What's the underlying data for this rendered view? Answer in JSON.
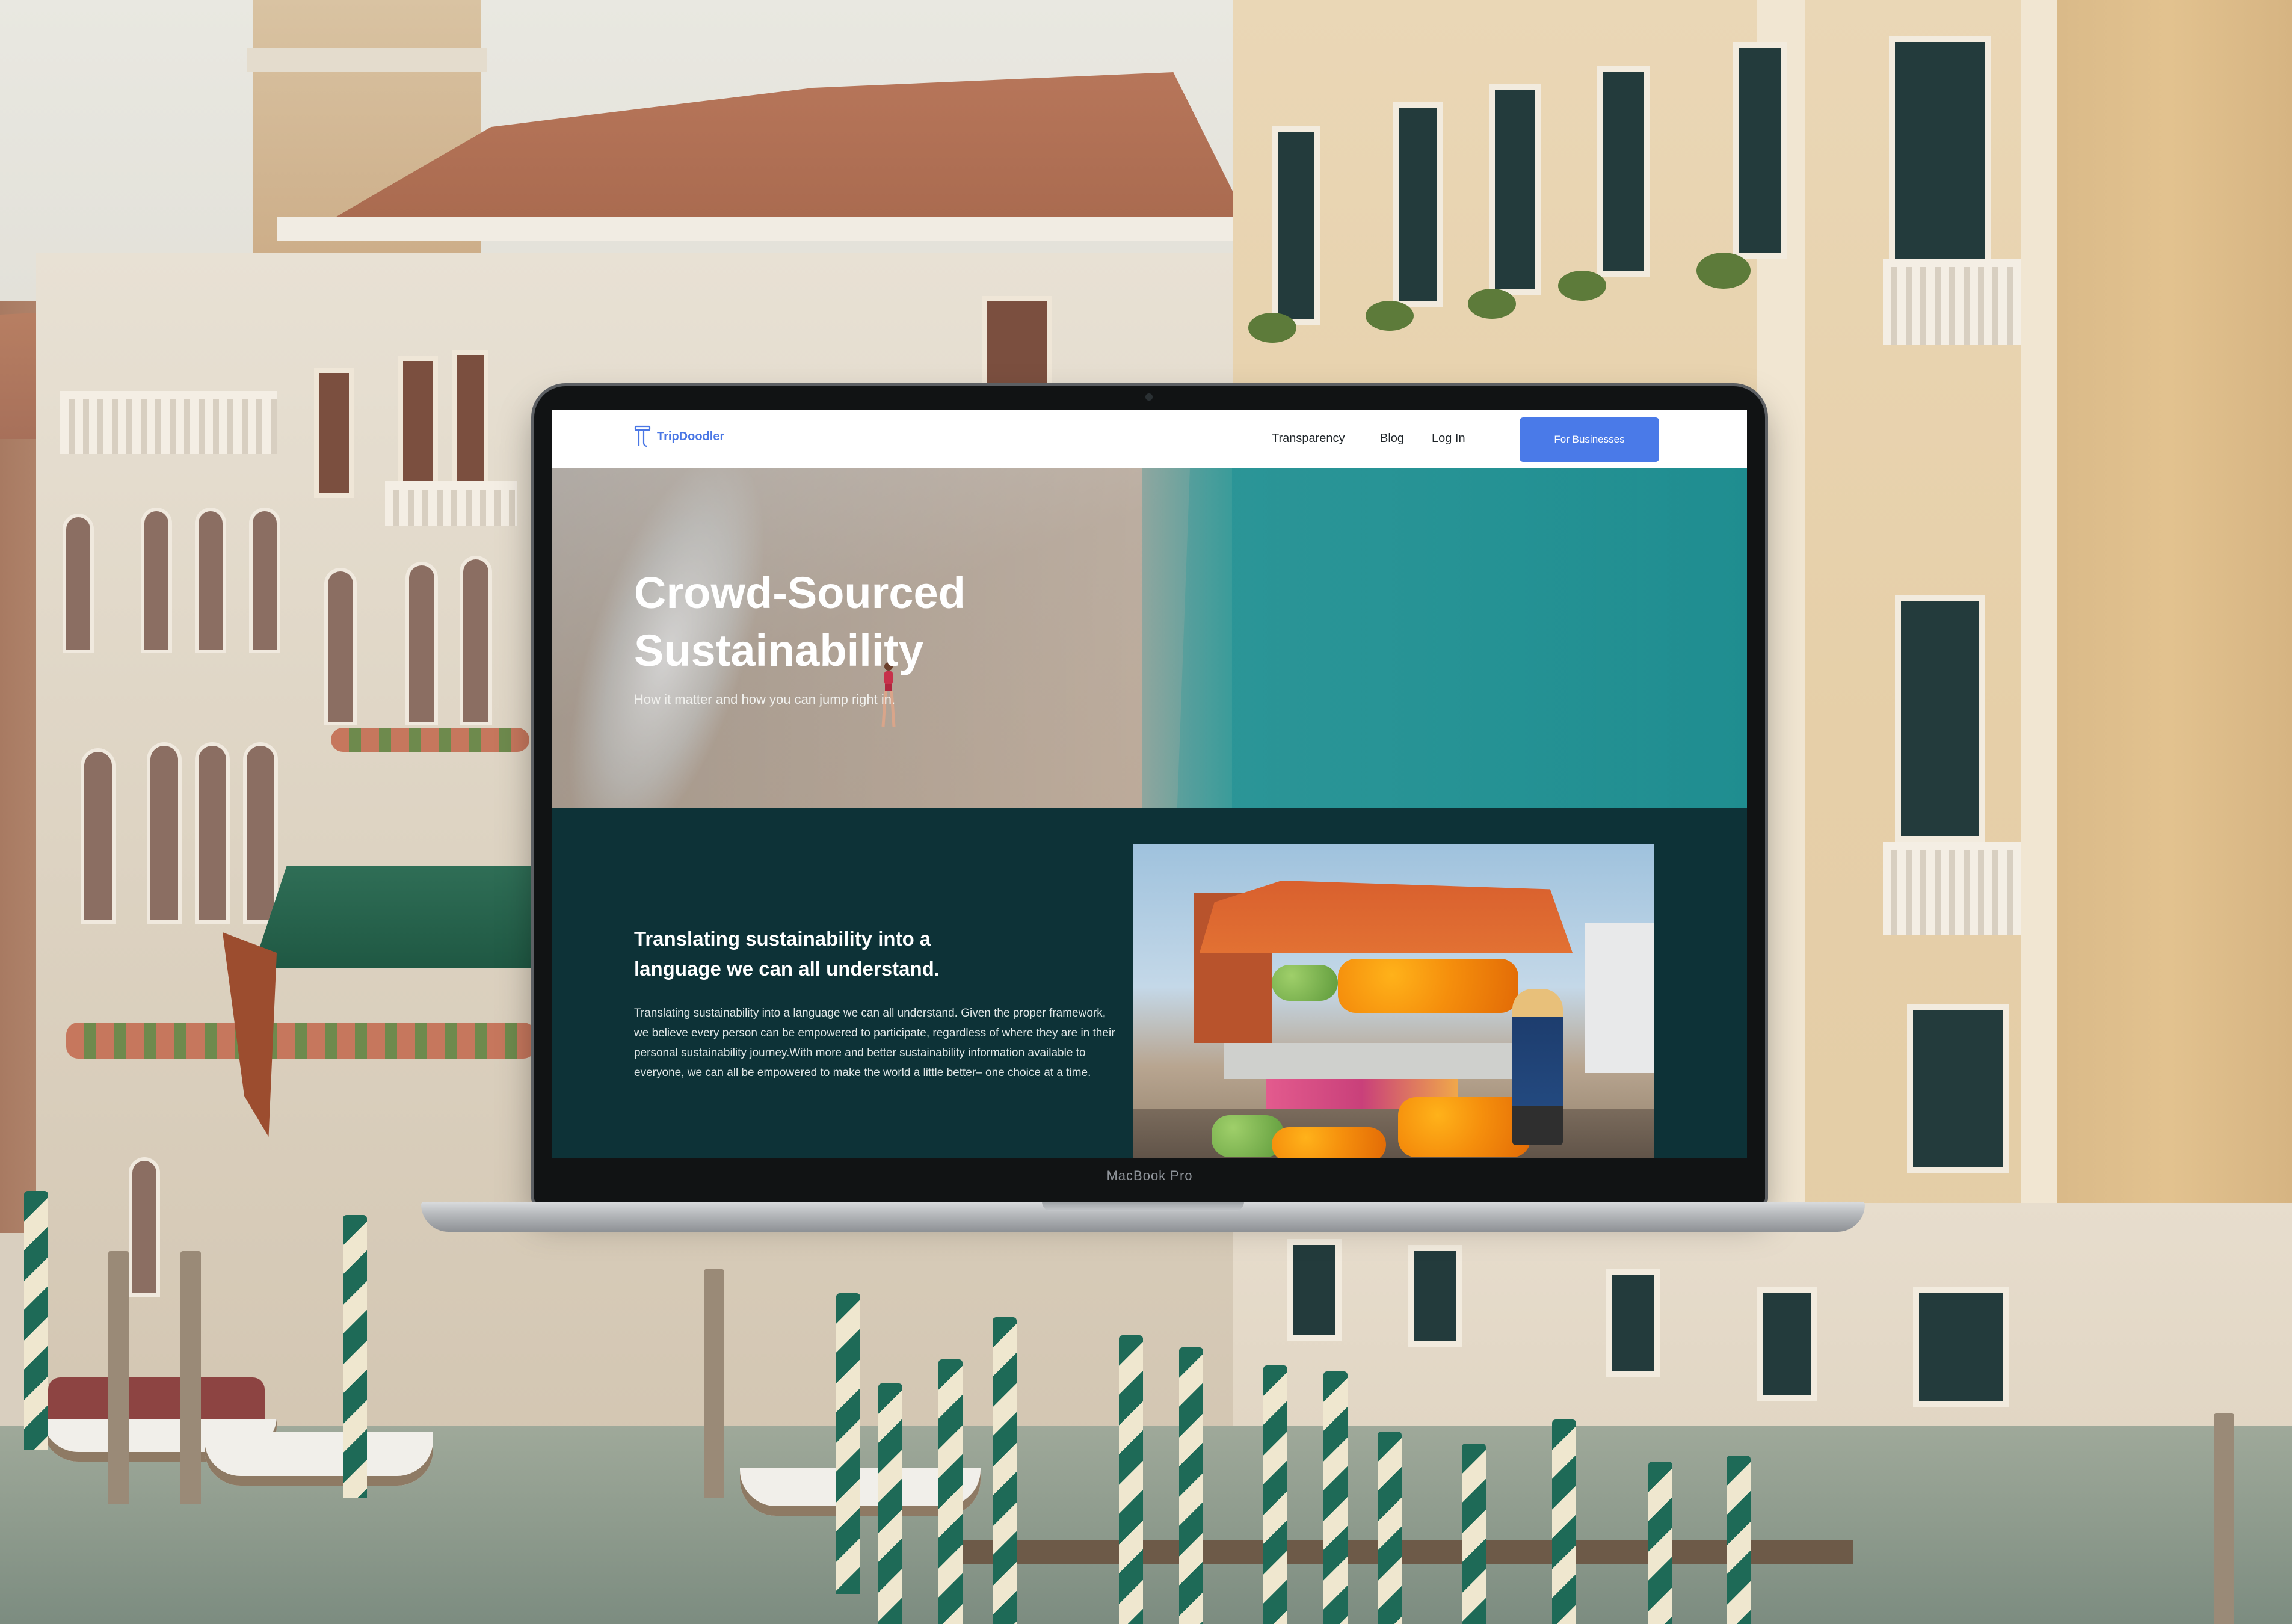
{
  "site": {
    "brand": "TripDoodler",
    "nav": {
      "links": [
        "Transparency",
        "Blog",
        "Log In"
      ],
      "cta": "For Businesses"
    },
    "hero": {
      "title": "Crowd-Sourced\nSustainability",
      "subtitle": "How it matter and how you can jump right in."
    },
    "section": {
      "heading": "Translating sustainability into a language we can all understand.",
      "body": "Translating sustainability into a language we can all understand. Given the proper framework, we believe every person can be empowered to participate, regardless of where they are in their personal sustainability journey.With more and better sustainability information available to everyone, we can all be empowered to make the world a little better– one choice at a time."
    }
  },
  "device": {
    "label": "MacBook Pro"
  },
  "colors": {
    "brand_blue": "#4a7ae8",
    "section_bg": "#0d3237",
    "hero_water": "#279799"
  }
}
